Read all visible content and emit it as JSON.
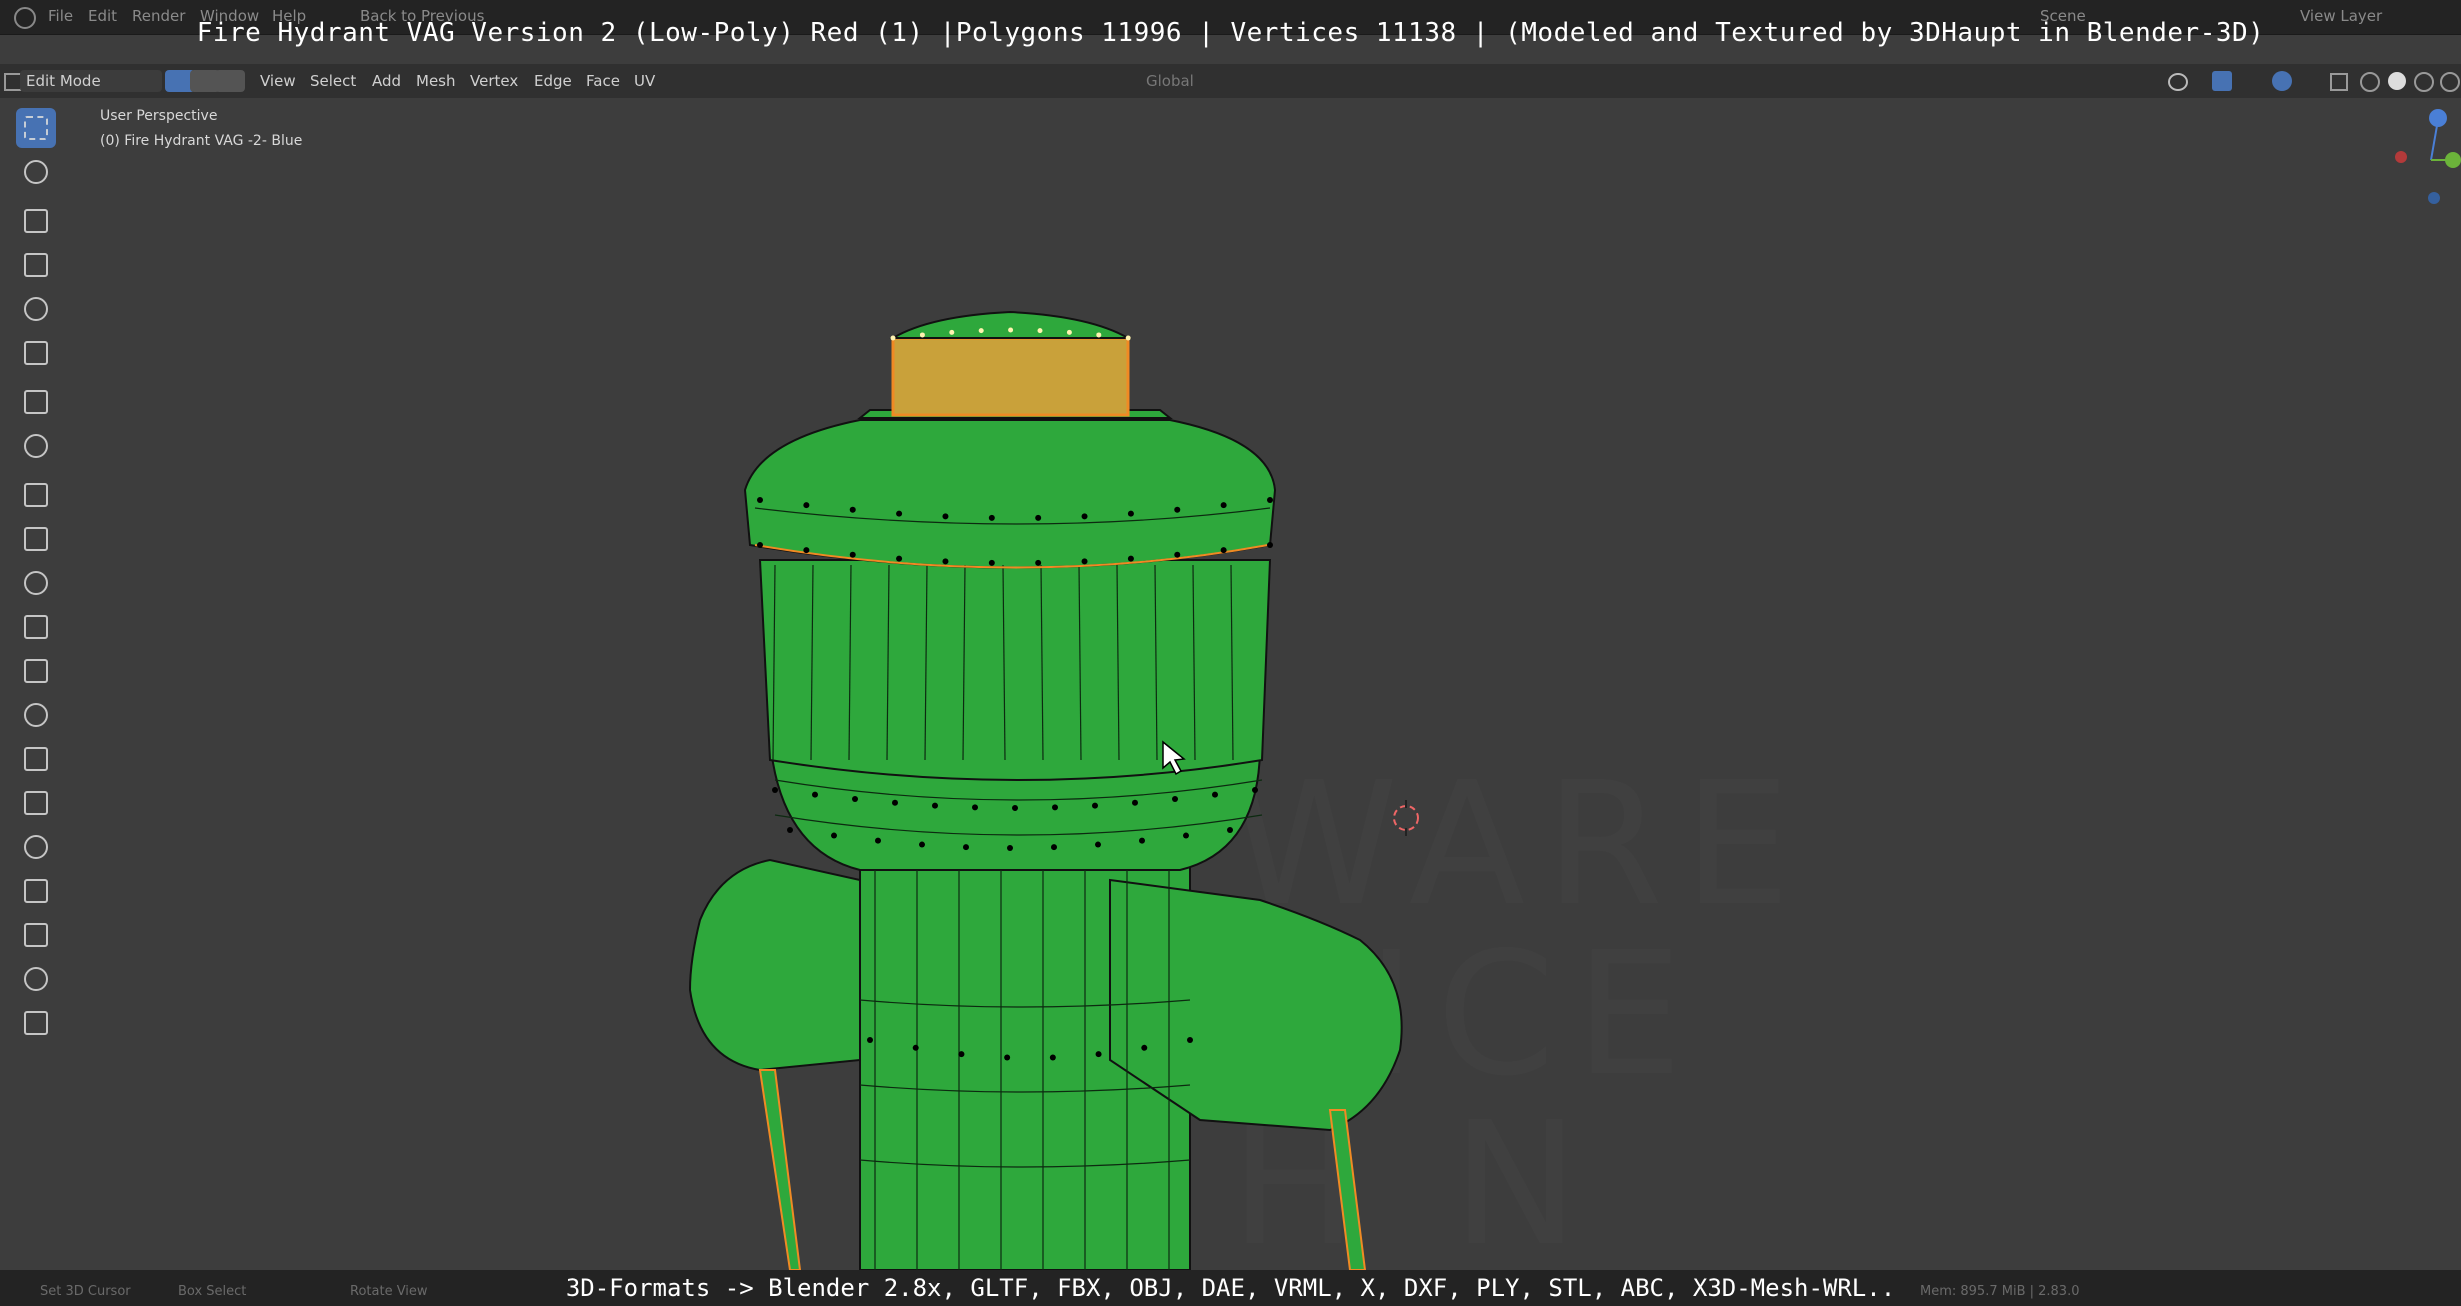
{
  "app": {
    "menu": [
      "File",
      "Edit",
      "Render",
      "Window",
      "Help"
    ],
    "back_label": "Back to Previous",
    "scene_label": "Scene",
    "view_layer_label": "View Layer",
    "transform_orientation": "Global"
  },
  "title_caption": "Fire Hydrant VAG Version 2 (Low-Poly) Red (1) |Polygons 11996 | Vertices 11138 | (Modeled and Textured by 3DHaupt in Blender-3D)",
  "header": {
    "mode": "Edit Mode",
    "menus": [
      "View",
      "Select",
      "Add",
      "Mesh",
      "Vertex",
      "Edge",
      "Face",
      "UV"
    ]
  },
  "viewport": {
    "perspective_label": "User Perspective",
    "object_label": "(0) Fire Hydrant VAG -2- Blue",
    "watermark_lines": [
      "WARE",
      "VICE",
      "H N"
    ]
  },
  "tools": [
    "select-box",
    "cursor",
    "move",
    "rotate",
    "scale",
    "transform",
    "annotate",
    "measure",
    "add-cube",
    "extrude",
    "inset",
    "bevel",
    "loop-cut",
    "knife",
    "poly-build",
    "spin",
    "smooth",
    "edge-slide",
    "shrink-fatten",
    "shear",
    "rip"
  ],
  "bottom_caption": "3D-Formats -> Blender 2.8x, GLTF, FBX, OBJ, DAE, VRML, X, DXF, PLY, STL, ABC, X3D-Mesh-WRL..",
  "status": {
    "left": "Set 3D Cursor",
    "middle": "Box Select",
    "right": "Rotate View",
    "stats": "Mem: 895.7 MiB | 2.83.0"
  },
  "colors": {
    "mesh": "#2ea83c",
    "selection": "#f08a24",
    "active_tool": "#4772b3"
  }
}
